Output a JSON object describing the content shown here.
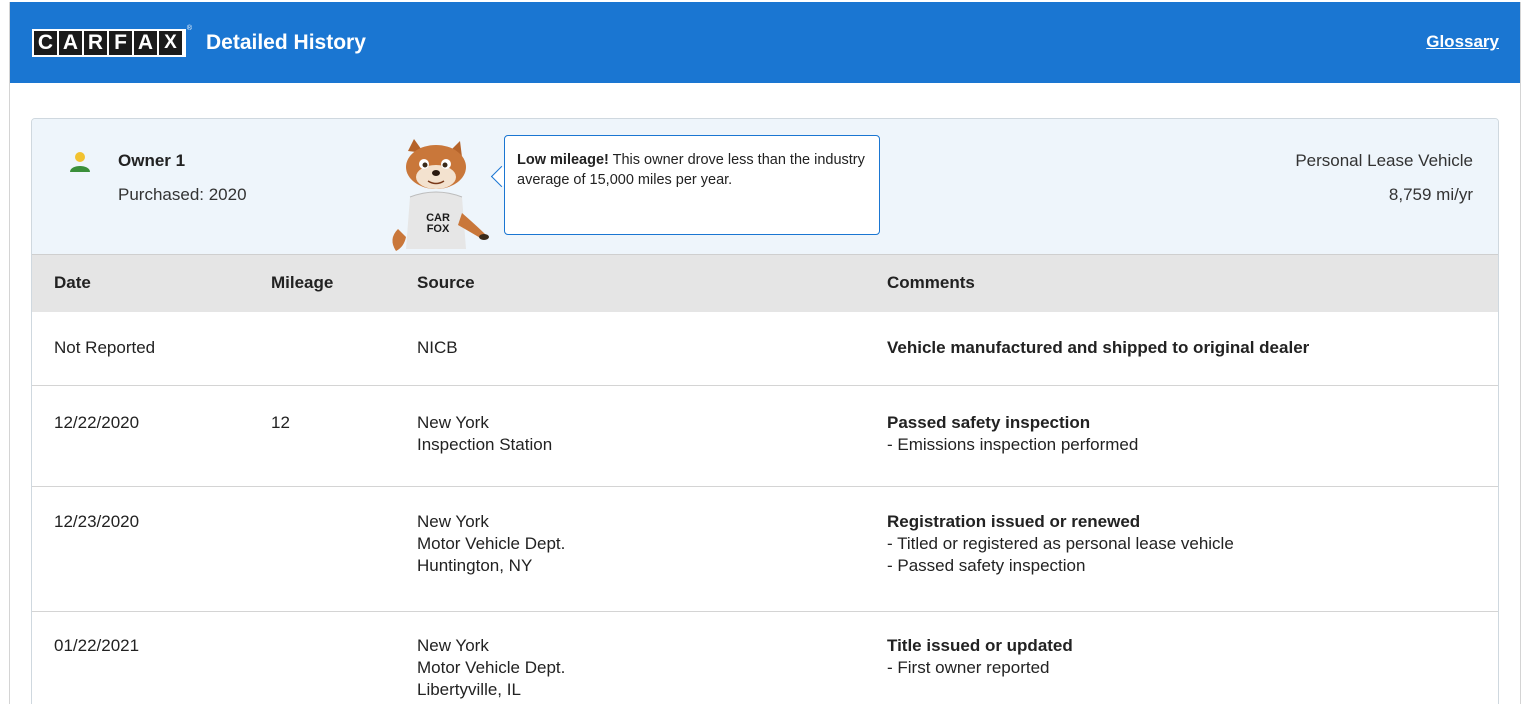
{
  "header": {
    "logo_letters": [
      "C",
      "A",
      "R",
      "F",
      "A",
      "X"
    ],
    "logo_reg": "®",
    "title": "Detailed History",
    "glossary_label": "Glossary"
  },
  "owner": {
    "name": "Owner 1",
    "purchased": "Purchased: 2020",
    "vehicle_type": "Personal Lease Vehicle",
    "miles_per_year": "8,759 mi/yr",
    "fox_shirt_text": "CAR FOX",
    "bubble": {
      "bold": "Low mileage!",
      "text": " This owner drove less than the industry average of 15,000 miles per year."
    }
  },
  "table": {
    "headers": {
      "date": "Date",
      "mileage": "Mileage",
      "source": "Source",
      "comments": "Comments"
    },
    "rows": [
      {
        "date": "Not Reported",
        "mileage": "",
        "source": [
          "NICB"
        ],
        "comment_title": "Vehicle manufactured and shipped to original dealer",
        "comment_lines": []
      },
      {
        "date": "12/22/2020",
        "mileage": "12",
        "source": [
          "New York",
          "Inspection Station"
        ],
        "comment_title": "Passed safety inspection",
        "comment_lines": [
          "- Emissions inspection performed"
        ]
      },
      {
        "date": "12/23/2020",
        "mileage": "",
        "source": [
          "New York",
          "Motor Vehicle Dept.",
          "Huntington, NY"
        ],
        "comment_title": "Registration issued or renewed",
        "comment_lines": [
          "- Titled or registered as personal lease vehicle",
          "- Passed safety inspection"
        ]
      },
      {
        "date": "01/22/2021",
        "mileage": "",
        "source": [
          "New York",
          "Motor Vehicle Dept.",
          "Libertyville, IL"
        ],
        "comment_title": "Title issued or updated",
        "comment_lines": [
          "- First owner reported"
        ]
      }
    ]
  },
  "colors": {
    "header_blue": "#1a76d2",
    "owner_panel_bg": "#eef5fb",
    "table_head_bg": "#e5e5e5",
    "person_icon_green": "#3a8f3a",
    "person_icon_yellow": "#f2c230"
  },
  "icons": {
    "owner": "person-icon",
    "mascot": "carfox-mascot"
  }
}
